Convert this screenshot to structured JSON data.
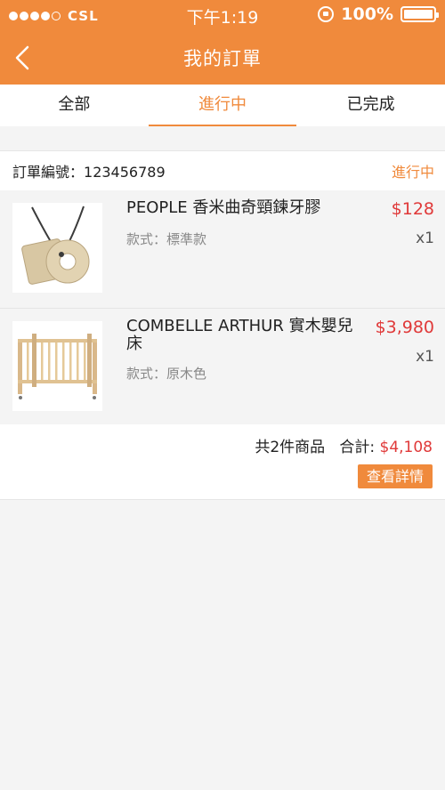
{
  "status_bar": {
    "carrier": "CSL",
    "time": "下午1:19",
    "battery": "100%"
  },
  "nav": {
    "title": "我的訂單"
  },
  "tabs": [
    {
      "label": "全部",
      "active": false
    },
    {
      "label": "進行中",
      "active": true
    },
    {
      "label": "已完成",
      "active": false
    }
  ],
  "order": {
    "number_label": "訂單編號：",
    "number": "123456789",
    "status": "進行中",
    "items": [
      {
        "name": "PEOPLE 香米曲奇頸鍊牙膠",
        "style_label": "款式：",
        "style": "標準款",
        "price": "$128",
        "qty": "x1",
        "image": "necklace-teether"
      },
      {
        "name": "COMBELLE ARTHUR 實木嬰兒床",
        "style_label": "款式：",
        "style": "原木色",
        "price": "$3,980",
        "qty": "x1",
        "image": "wooden-crib"
      }
    ],
    "summary_count": "共2件商品",
    "summary_total_label": "合計:",
    "summary_total": "$4,108",
    "detail_button": "查看詳情"
  },
  "colors": {
    "accent": "#f08a3c",
    "price": "#e03939"
  }
}
